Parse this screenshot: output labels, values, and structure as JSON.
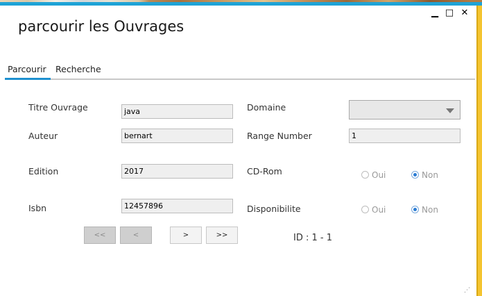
{
  "window": {
    "title": "parcourir les Ouvrages",
    "controls": {
      "minimize": "▁",
      "maximize": "□",
      "close": "✕"
    }
  },
  "tabs": [
    {
      "label": "Parcourir",
      "active": true
    },
    {
      "label": "Recherche",
      "active": false
    }
  ],
  "form": {
    "titre_label": "Titre Ouvrage",
    "titre_value": "java",
    "auteur_label": "Auteur",
    "auteur_value": "bernart",
    "edition_label": "Edition",
    "edition_value": "2017",
    "isbn_label": "Isbn",
    "isbn_value": "12457896",
    "domaine_label": "Domaine",
    "domaine_value": "",
    "range_label": "Range Number",
    "range_value": "1",
    "cdrom_label": "CD-Rom",
    "cdrom_oui": "Oui",
    "cdrom_non": "Non",
    "cdrom_selected": "Non",
    "dispo_label": "Disponibilite",
    "dispo_oui": "Oui",
    "dispo_non": "Non",
    "dispo_selected": "Non"
  },
  "navigation": {
    "first": "<<",
    "prev": "<",
    "next": ">",
    "last": ">>",
    "id_text": "ID : 1 - 1"
  },
  "colors": {
    "accent": "#1ea3d6",
    "tab_active": "#1e90d0",
    "window_border": "#f4c430",
    "radio_checked": "#2b7cd3"
  }
}
